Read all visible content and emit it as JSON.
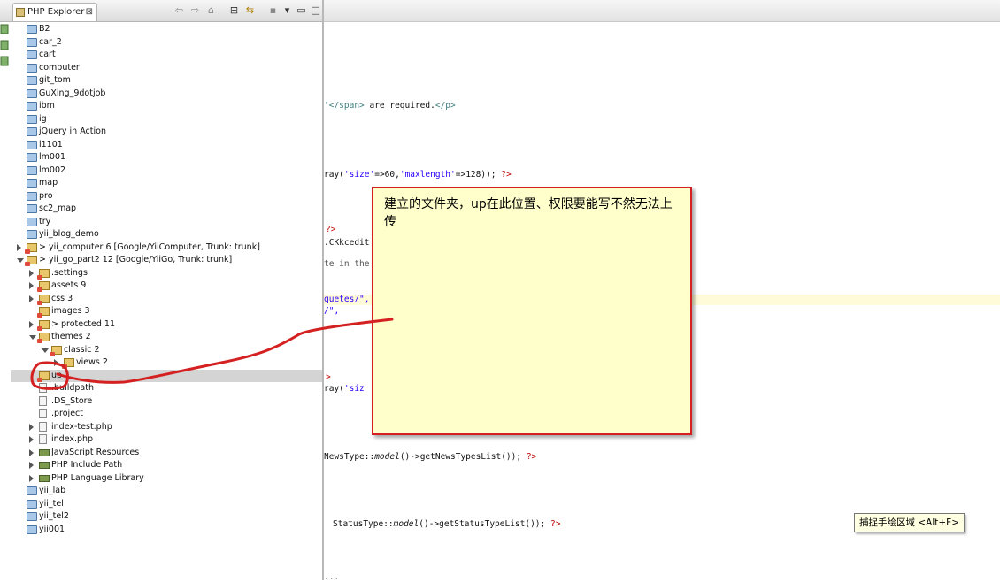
{
  "explorer": {
    "tab_title": "PHP Explorer",
    "tab_close": "⊠",
    "toolbar_icons": [
      "back-arrow-icon",
      "forward-arrow-icon",
      "home-icon",
      "collapse-all-icon",
      "link-editor-icon",
      "menu-icon",
      "view-menu-icon",
      "minimize-icon",
      "maximize-icon"
    ],
    "items": [
      {
        "label": "B2",
        "indent": 0,
        "icon": "folder",
        "arrow": "none"
      },
      {
        "label": "car_2",
        "indent": 0,
        "icon": "folder",
        "arrow": "none"
      },
      {
        "label": "cart",
        "indent": 0,
        "icon": "folder",
        "arrow": "none"
      },
      {
        "label": "computer",
        "indent": 0,
        "icon": "folder",
        "arrow": "none"
      },
      {
        "label": "git_tom",
        "indent": 0,
        "icon": "folder",
        "arrow": "none"
      },
      {
        "label": "GuXing_9dotjob",
        "indent": 0,
        "icon": "folder",
        "arrow": "none"
      },
      {
        "label": "ibm",
        "indent": 0,
        "icon": "folder",
        "arrow": "none"
      },
      {
        "label": "ig",
        "indent": 0,
        "icon": "folder",
        "arrow": "none"
      },
      {
        "label": "jQuery in Action",
        "indent": 0,
        "icon": "folder",
        "arrow": "none"
      },
      {
        "label": "l1101",
        "indent": 0,
        "icon": "folder",
        "arrow": "none"
      },
      {
        "label": "lm001",
        "indent": 0,
        "icon": "folder",
        "arrow": "none"
      },
      {
        "label": "lm002",
        "indent": 0,
        "icon": "folder",
        "arrow": "none"
      },
      {
        "label": "map",
        "indent": 0,
        "icon": "folder",
        "arrow": "none"
      },
      {
        "label": "pro",
        "indent": 0,
        "icon": "folder",
        "arrow": "none"
      },
      {
        "label": "sc2_map",
        "indent": 0,
        "icon": "folder",
        "arrow": "none"
      },
      {
        "label": "try",
        "indent": 0,
        "icon": "folder",
        "arrow": "none"
      },
      {
        "label": "yii_blog_demo",
        "indent": 0,
        "icon": "folder",
        "arrow": "none"
      },
      {
        "label": "> yii_computer 6 [Google/YiiComputer, Trunk: trunk]",
        "indent": 0,
        "icon": "project",
        "arrow": "right"
      },
      {
        "label": "> yii_go_part2 12 [Google/YiiGo, Trunk: trunk]",
        "indent": 0,
        "icon": "project",
        "arrow": "down"
      },
      {
        "label": ".settings",
        "indent": 1,
        "icon": "project",
        "arrow": "right"
      },
      {
        "label": "assets 9",
        "indent": 1,
        "icon": "project",
        "arrow": "right"
      },
      {
        "label": "css 3",
        "indent": 1,
        "icon": "project",
        "arrow": "right"
      },
      {
        "label": "images 3",
        "indent": 1,
        "icon": "project",
        "arrow": "none"
      },
      {
        "label": "> protected 11",
        "indent": 1,
        "icon": "project",
        "arrow": "right"
      },
      {
        "label": "themes 2",
        "indent": 1,
        "icon": "project",
        "arrow": "down"
      },
      {
        "label": "classic 2",
        "indent": 2,
        "icon": "project",
        "arrow": "down"
      },
      {
        "label": "views 2",
        "indent": 3,
        "icon": "project",
        "arrow": "right"
      },
      {
        "label": "up",
        "indent": 1,
        "icon": "project",
        "arrow": "none",
        "selected": true
      },
      {
        "label": ".buildpath",
        "indent": 1,
        "icon": "file",
        "arrow": "none"
      },
      {
        "label": ".DS_Store",
        "indent": 1,
        "icon": "file",
        "arrow": "none"
      },
      {
        "label": ".project",
        "indent": 1,
        "icon": "file",
        "arrow": "none"
      },
      {
        "label": "index-test.php",
        "indent": 1,
        "icon": "file",
        "arrow": "right"
      },
      {
        "label": "index.php",
        "indent": 1,
        "icon": "file",
        "arrow": "right"
      },
      {
        "label": "JavaScript Resources",
        "indent": 1,
        "icon": "lib",
        "arrow": "right"
      },
      {
        "label": "PHP Include Path",
        "indent": 1,
        "icon": "lib",
        "arrow": "right"
      },
      {
        "label": "PHP Language Library",
        "indent": 1,
        "icon": "lib",
        "arrow": "right"
      },
      {
        "label": "yii_lab",
        "indent": 0,
        "icon": "folder",
        "arrow": "none"
      },
      {
        "label": "yii_tel",
        "indent": 0,
        "icon": "folder",
        "arrow": "none"
      },
      {
        "label": "yii_tel2",
        "indent": 0,
        "icon": "folder",
        "arrow": "none"
      },
      {
        "label": "yii001",
        "indent": 0,
        "icon": "folder",
        "arrow": "none"
      }
    ]
  },
  "editor": {
    "line1": {
      "a": "'</span>",
      "b": " are required.",
      "c": "</p>"
    },
    "line2": {
      "a": "ray(",
      "b": "'size'",
      "c": "=>60,",
      "d": "'maxlength'",
      "e": "=>128)); ",
      "f": "?>"
    },
    "line3": {
      "a": "?>"
    },
    "line4": {
      "a": ".CKkcedit"
    },
    "line5": {
      "a": "te in the"
    },
    "line6": {
      "a": "quetes/\","
    },
    "line7": {
      "a": "/\","
    },
    "line8": {
      "a": ">"
    },
    "line9": {
      "a": "ray(",
      "b": "'siz"
    },
    "line10": {
      "a": "NewsType::",
      "b": "model",
      "c": "()->getNewsTypesList()); ",
      "d": "?>"
    },
    "line11": {
      "a": "StatusType::",
      "b": "model",
      "c": "()->getStatusTypeList()); ",
      "d": "?>"
    },
    "line12": {
      "a": "..."
    }
  },
  "note": {
    "text": "建立的文件夹，up在此位置、权限要能写不然无法上传",
    "border_color": "#d42020",
    "background_color": "#ffffcc"
  },
  "tooltip": {
    "text": "捕捉手绘区域 <Alt+F>"
  },
  "annotation": {
    "color": "#d42020"
  }
}
